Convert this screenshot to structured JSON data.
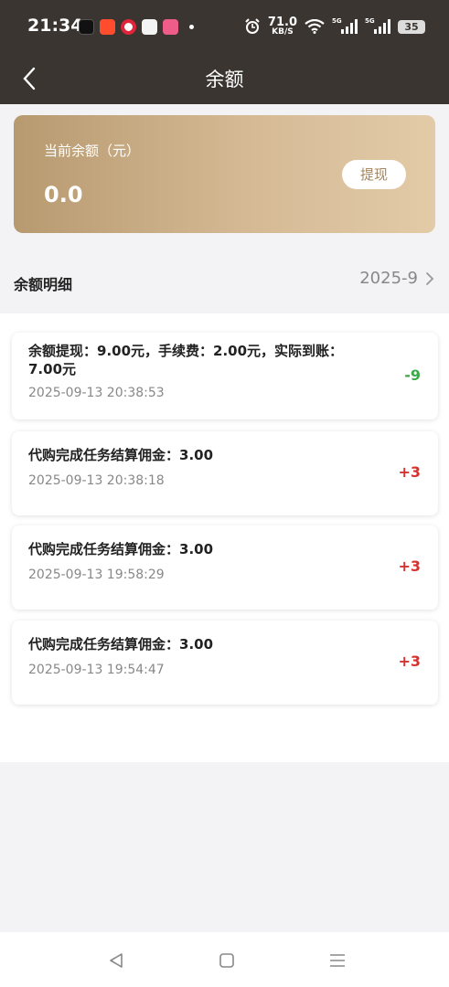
{
  "status_bar": {
    "time": "21:34",
    "net_speed_value": "71.0",
    "net_speed_unit": "KB/S",
    "sim1": "5G",
    "sim2": "5G",
    "battery": "35"
  },
  "header": {
    "title": "余额"
  },
  "balance": {
    "label": "当前余额（元）",
    "value": "0.0",
    "withdraw_label": "提现"
  },
  "details": {
    "title": "余额明细",
    "month": "2025-9"
  },
  "transactions": [
    {
      "title": "余额提现：9.00元，手续费：2.00元，实际到账：7.00元",
      "time": "2025-09-13 20:38:53",
      "amount": "-9",
      "color": "#3daa4a"
    },
    {
      "title": "代购完成任务结算佣金：3.00",
      "time": "2025-09-13 20:38:18",
      "amount": "+3",
      "color": "#d93030"
    },
    {
      "title": "代购完成任务结算佣金：3.00",
      "time": "2025-09-13 19:58:29",
      "amount": "+3",
      "color": "#d93030"
    },
    {
      "title": "代购完成任务结算佣金：3.00",
      "time": "2025-09-13 19:54:47",
      "amount": "+3",
      "color": "#d93030"
    }
  ],
  "colors": {
    "header_bg": "#3a3530",
    "card_gradient_start": "#b89a70",
    "card_gradient_end": "#e3cba8",
    "income": "#d93030",
    "expense": "#3daa4a"
  }
}
